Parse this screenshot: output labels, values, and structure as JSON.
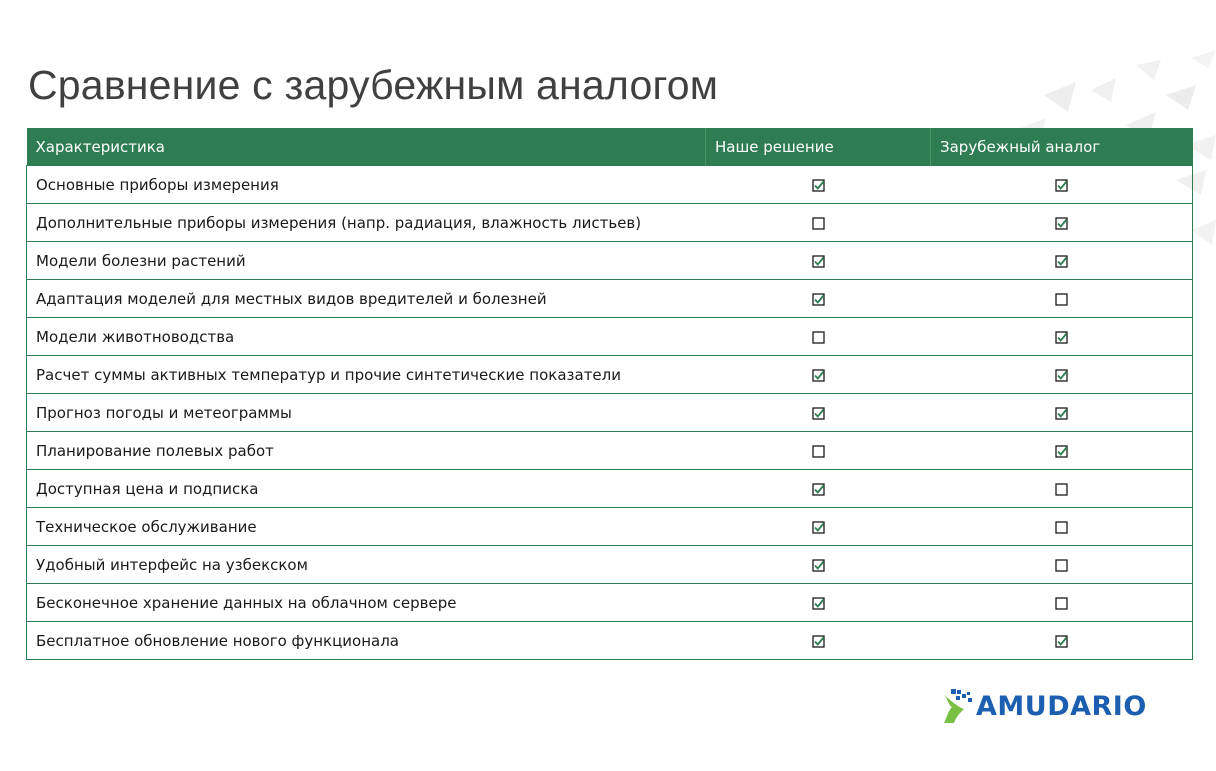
{
  "slide": {
    "title": "Сравнение с зарубежным аналогом",
    "brand": "AMUDARIO"
  },
  "table": {
    "headers": [
      "Характеристика",
      "Наше решение",
      "Зарубежный аналог"
    ],
    "rows": [
      {
        "feature": "Основные приборы измерения",
        "ours": true,
        "foreign": true
      },
      {
        "feature": "Дополнительные приборы измерения (напр.  радиация, влажность листьев)",
        "ours": false,
        "foreign": true
      },
      {
        "feature": "Модели болезни растений",
        "ours": true,
        "foreign": true
      },
      {
        "feature": "Адаптация моделей для местных видов вредителей и болезней",
        "ours": true,
        "foreign": false
      },
      {
        "feature": "Модели животноводства",
        "ours": false,
        "foreign": true
      },
      {
        "feature": "Расчет суммы активных температур и прочие синтетические показатели",
        "ours": true,
        "foreign": true
      },
      {
        "feature": "Прогноз погоды и метеограммы",
        "ours": true,
        "foreign": true
      },
      {
        "feature": "Планирование полевых работ",
        "ours": false,
        "foreign": true
      },
      {
        "feature": "Доступная цена и подписка",
        "ours": true,
        "foreign": false
      },
      {
        "feature": "Техническое обслуживание",
        "ours": true,
        "foreign": false
      },
      {
        "feature": "Удобный интерфейс на узбекском",
        "ours": true,
        "foreign": false
      },
      {
        "feature": "Бесконечное хранение данных на облачном сервере",
        "ours": true,
        "foreign": false
      },
      {
        "feature": "Бесплатное обновление нового функционала",
        "ours": true,
        "foreign": true
      }
    ]
  },
  "colors": {
    "header_bg": "#2e7d52",
    "check": "#2e7d52",
    "brand_blue": "#1c5fb0",
    "brand_green": "#7ac143"
  },
  "icons": {
    "checked": "checked-checkbox-icon",
    "unchecked": "empty-checkbox-icon"
  }
}
